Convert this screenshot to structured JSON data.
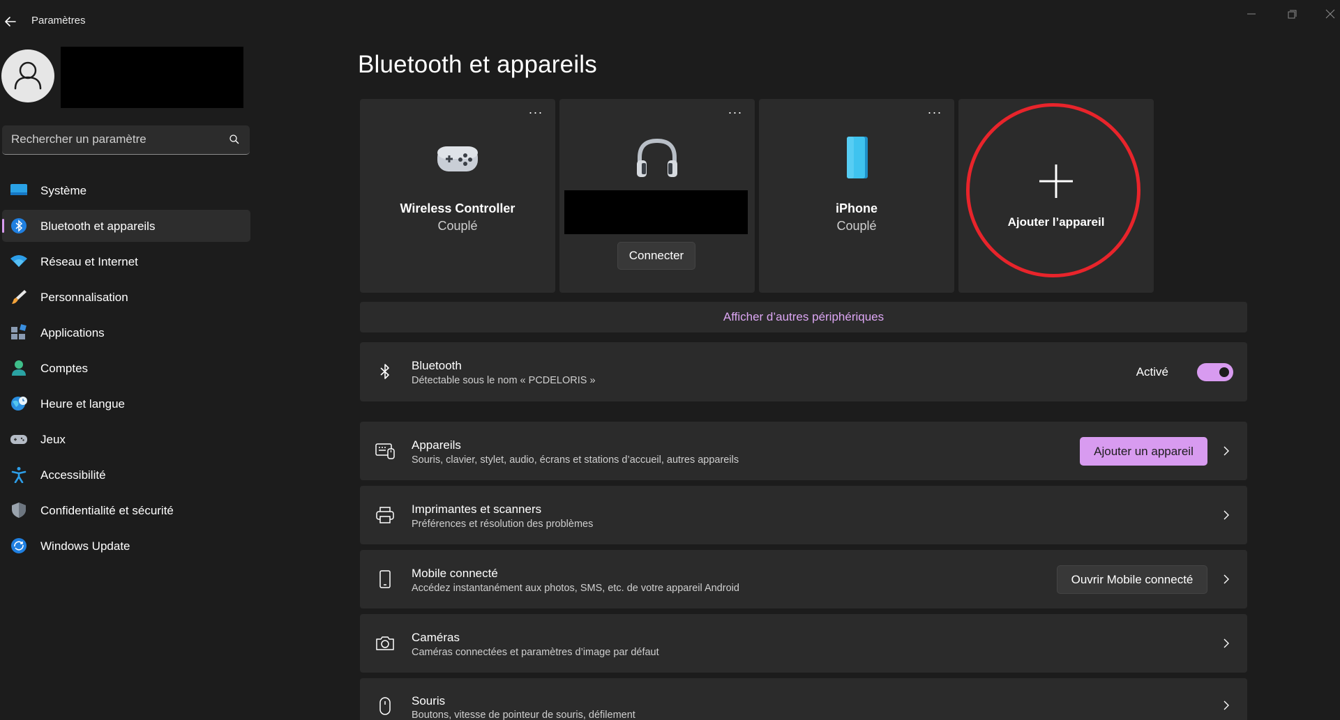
{
  "window": {
    "title": "Paramètres"
  },
  "sidebar": {
    "search_placeholder": "Rechercher un paramètre",
    "items": [
      {
        "label": "Système",
        "icon": "system-icon"
      },
      {
        "label": "Bluetooth et appareils",
        "icon": "bluetooth-icon",
        "active": true
      },
      {
        "label": "Réseau et Internet",
        "icon": "wifi-icon"
      },
      {
        "label": "Personnalisation",
        "icon": "brush-icon"
      },
      {
        "label": "Applications",
        "icon": "apps-icon"
      },
      {
        "label": "Comptes",
        "icon": "account-icon"
      },
      {
        "label": "Heure et langue",
        "icon": "globe-clock-icon"
      },
      {
        "label": "Jeux",
        "icon": "gamepad-icon"
      },
      {
        "label": "Accessibilité",
        "icon": "accessibility-icon"
      },
      {
        "label": "Confidentialité et sécurité",
        "icon": "shield-icon"
      },
      {
        "label": "Windows Update",
        "icon": "update-icon"
      }
    ]
  },
  "main": {
    "title": "Bluetooth et appareils",
    "devices": [
      {
        "name": "Wireless Controller",
        "status": "Couplé",
        "icon": "gamepad-icon"
      },
      {
        "name": "",
        "status": "",
        "icon": "headphones-icon",
        "action": "Connecter"
      },
      {
        "name": "iPhone",
        "status": "Couplé",
        "icon": "phone-icon"
      }
    ],
    "add_device_label": "Ajouter l’appareil",
    "show_more_label": "Afficher d’autres périphériques",
    "bluetooth": {
      "title": "Bluetooth",
      "subtitle": "Détectable sous le nom « PCDELORIS »",
      "state_label": "Activé",
      "enabled": true
    },
    "rows": [
      {
        "title": "Appareils",
        "subtitle": "Souris, clavier, stylet, audio, écrans et stations d’accueil, autres appareils",
        "button": "Ajouter un appareil",
        "icon": "devices-icon"
      },
      {
        "title": "Imprimantes et scanners",
        "subtitle": "Préférences et résolution des problèmes",
        "icon": "printer-icon"
      },
      {
        "title": "Mobile connecté",
        "subtitle": "Accédez instantanément aux photos, SMS, etc. de votre appareil Android",
        "button": "Ouvrir Mobile connecté",
        "icon": "mobile-icon"
      },
      {
        "title": "Caméras",
        "subtitle": "Caméras connectées et paramètres d’image par défaut",
        "icon": "camera-icon"
      },
      {
        "title": "Souris",
        "subtitle": "Boutons, vitesse de pointeur de souris, défilement",
        "icon": "mouse-icon"
      }
    ]
  },
  "colors": {
    "background": "#1c1c1c",
    "card": "#2b2b2b",
    "accent": "#d89bf0",
    "highlight_circle": "#e8242b"
  }
}
